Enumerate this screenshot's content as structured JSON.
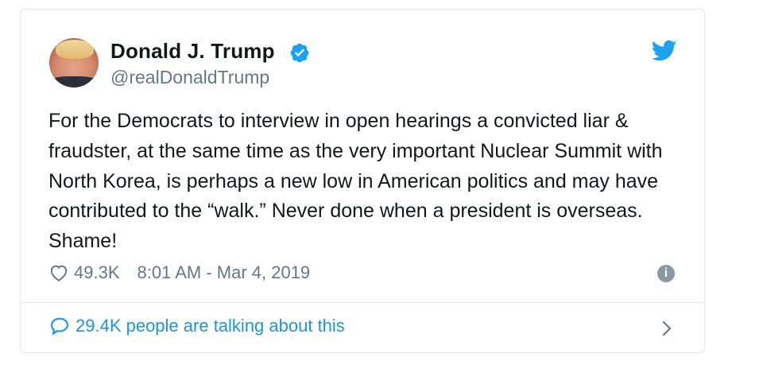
{
  "tweet": {
    "author_name": "Donald J. Trump",
    "handle": "@realDonaldTrump",
    "text": "For the Democrats to interview in open hearings a convicted liar & fraudster, at the same time as the very important Nuclear Summit with North Korea, is perhaps a new low in American politics and may have contributed to the “walk.” Never done when a president is overseas. Shame!",
    "likes": "49.3K",
    "timestamp": "8:01 AM - Mar 4, 2019",
    "talking_about": "29.4K people are talking about this"
  },
  "icons": {
    "verified": "verified-badge-icon",
    "brand": "twitter-bird-icon",
    "like": "heart-icon",
    "info": "info-icon",
    "conversation": "speech-bubble-icon",
    "chevron": "chevron-right-icon"
  },
  "colors": {
    "twitter_blue": "#1da1f2",
    "link_blue": "#1b95e0",
    "secondary_text": "#657786",
    "border": "#e1e8ed"
  }
}
